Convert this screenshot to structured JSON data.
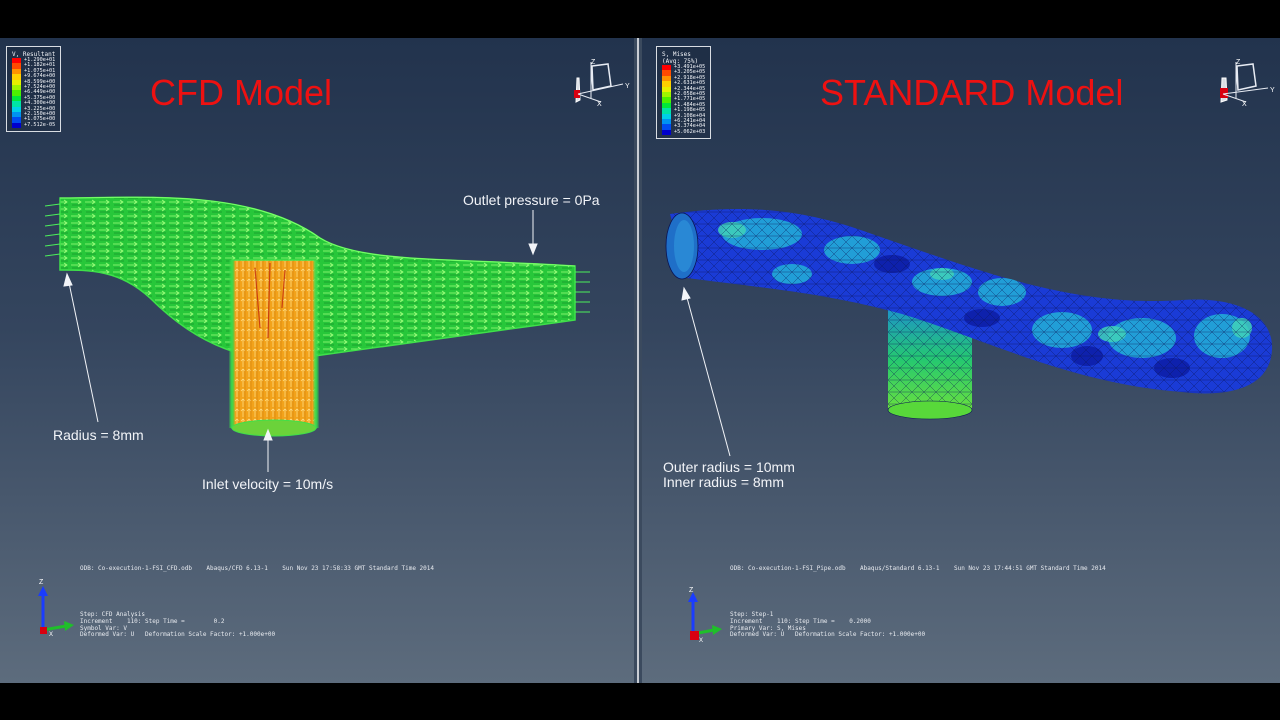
{
  "left": {
    "title": "CFD Model",
    "legend": {
      "title": "V, Resultant",
      "values": [
        "+1.290e+01",
        "+1.182e+01",
        "+1.075e+01",
        "+9.674e+00",
        "+8.599e+00",
        "+7.524e+00",
        "+6.449e+00",
        "+5.375e+00",
        "+4.300e+00",
        "+3.225e+00",
        "+2.150e+00",
        "+1.075e+00",
        "+7.512e-05"
      ],
      "colors": [
        "#ff0000",
        "#ff4a00",
        "#ff9200",
        "#ffd000",
        "#e8f000",
        "#9ff500",
        "#4cf000",
        "#00e83a",
        "#00e3a6",
        "#00cfe8",
        "#0093f0",
        "#004cf0",
        "#0000cc"
      ]
    },
    "annotations": {
      "outlet": "Outlet pressure = 0Pa",
      "radius": "Radius = 8mm",
      "inlet": "Inlet velocity = 10m/s"
    },
    "odb_line": "ODB: Co-execution-1-FSI_CFD.odb    Abaqus/CFD 6.13-1    Sun Nov 23 17:58:33 GMT Standard Time 2014",
    "step_lines": [
      "Step: CFD Analysis",
      "Increment    110: Step Time =        0.2",
      "Symbol Var: V",
      "Deformed Var: U   Deformation Scale Factor: +1.000e+00"
    ]
  },
  "right": {
    "title": "STANDARD Model",
    "legend": {
      "title": "S, Mises\n(Avg: 75%)",
      "values": [
        "+3.491e+05",
        "+3.205e+05",
        "+2.918e+05",
        "+2.631e+05",
        "+2.344e+05",
        "+2.058e+05",
        "+1.771e+05",
        "+1.484e+05",
        "+1.198e+05",
        "+9.108e+04",
        "+6.241e+04",
        "+3.374e+04",
        "+5.062e+03"
      ],
      "colors": [
        "#ff0000",
        "#ff4a00",
        "#ff9200",
        "#ffd000",
        "#e8f000",
        "#9ff500",
        "#4cf000",
        "#00e83a",
        "#00e3a6",
        "#00cfe8",
        "#0093f0",
        "#004cf0",
        "#0000cc"
      ]
    },
    "annotations": {
      "outer": "Outer radius = 10mm",
      "inner": "Inner radius = 8mm"
    },
    "odb_line": "ODB: Co-execution-1-FSI_Pipe.odb    Abaqus/Standard 6.13-1    Sun Nov 23 17:44:51 GMT Standard Time 2014",
    "step_lines": [
      "Step: Step-1",
      "Increment    110: Step Time =    0.2000",
      "Primary Var: S, Mises",
      "Deformed Var: U   Deformation Scale Factor: +1.000e+00"
    ]
  },
  "triad": {
    "x": "X",
    "y": "Y",
    "z": "Z"
  },
  "icons": [
    "view-triad-icon",
    "coordinate-axes-icon"
  ]
}
